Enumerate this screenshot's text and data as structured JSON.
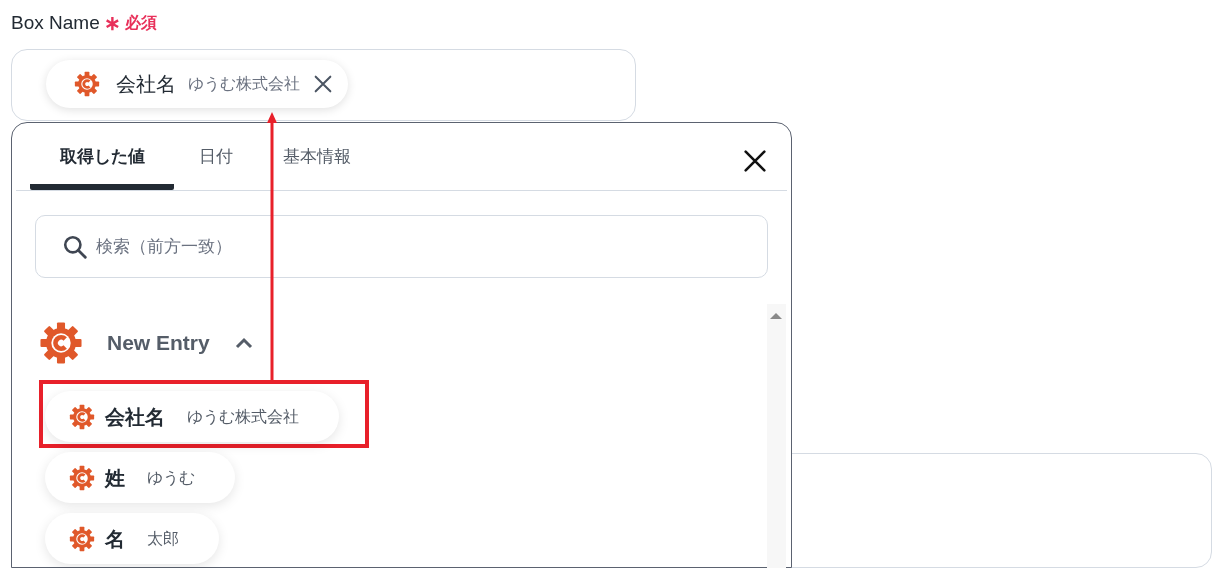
{
  "field": {
    "label": "Box Name",
    "required_mark": "∗",
    "required_text": "必須",
    "chip": {
      "label": "会社名",
      "value": "ゆうむ株式会社"
    }
  },
  "popover": {
    "tabs": [
      {
        "label": "取得した値",
        "selected": true
      },
      {
        "label": "日付",
        "selected": false
      },
      {
        "label": "基本情報",
        "selected": false
      }
    ],
    "search": {
      "placeholder": "検索（前方一致）"
    },
    "groups": [
      {
        "title": "New Entry",
        "expanded": true,
        "items": [
          {
            "label": "会社名",
            "value": "ゆうむ株式会社",
            "highlighted": true
          },
          {
            "label": "姓",
            "value": "ゆうむ",
            "highlighted": false
          },
          {
            "label": "名",
            "value": "太郎",
            "highlighted": false
          }
        ]
      }
    ]
  }
}
